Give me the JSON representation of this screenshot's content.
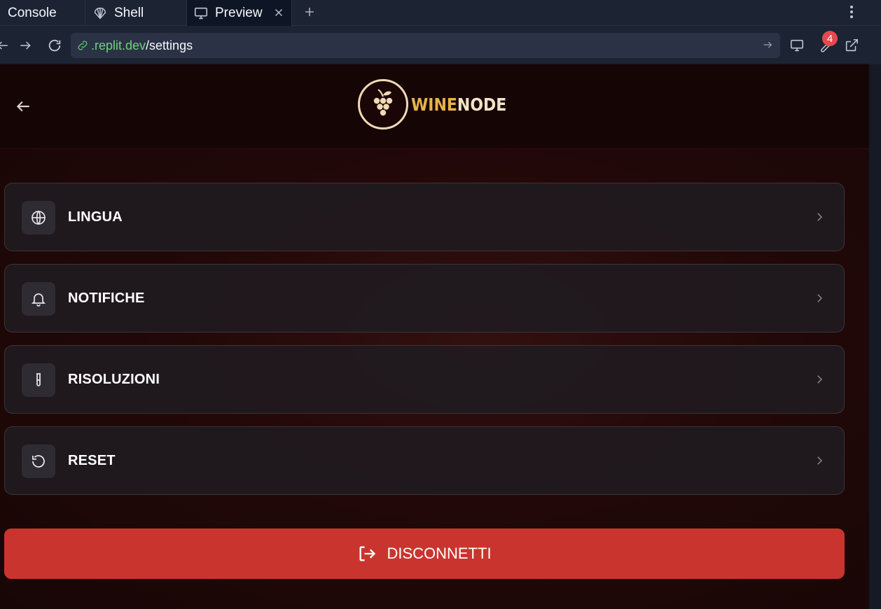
{
  "browser": {
    "tabs": [
      {
        "label": "Console",
        "icon": "console-icon"
      },
      {
        "label": "Shell",
        "icon": "shell-icon"
      },
      {
        "label": "Preview",
        "icon": "monitor-icon",
        "active": true
      }
    ],
    "url": {
      "host": ".replit.dev",
      "path": "/settings"
    },
    "badge_count": "4"
  },
  "app": {
    "logo": {
      "wine": "WINE",
      "node": "NODE"
    },
    "menu": [
      {
        "label": "LINGUA",
        "icon": "globe-icon"
      },
      {
        "label": "NOTIFICHE",
        "icon": "bell-icon"
      },
      {
        "label": "RISOLUZIONI",
        "icon": "test-tube-icon"
      },
      {
        "label": "RESET",
        "icon": "rotate-ccw-icon"
      }
    ],
    "logout_label": "DISCONNETTI"
  },
  "colors": {
    "accent_red": "#c9352e",
    "logo_gold": "#e8b24a",
    "url_host_green": "#6fd27f",
    "badge_red": "#e5484d"
  }
}
